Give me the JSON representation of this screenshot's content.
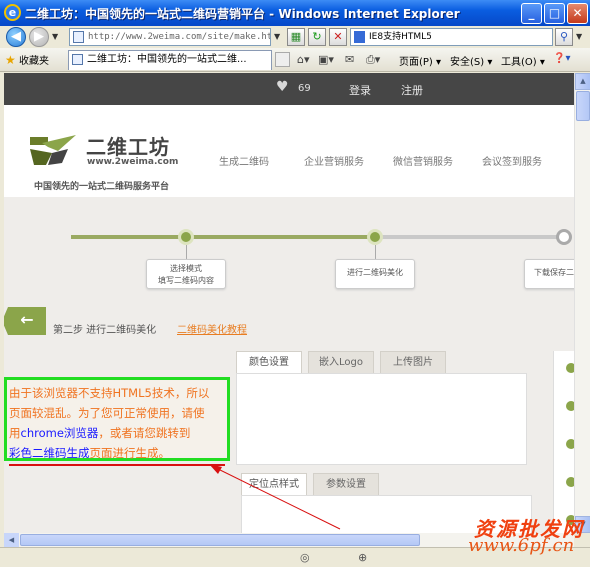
{
  "window": {
    "title": "二维工坊：中国领先的一站式二维码营销平台 - Windows Internet Explorer",
    "min": "_",
    "max": "□",
    "close": "✕"
  },
  "addressbar": {
    "url": "http://www.2weima.com/site/make.html",
    "search_value": "IE8支持HTML5"
  },
  "favbar": {
    "favorites_label": "收藏夹",
    "tab_title": "二维工坊：中国领先的一站式二维...",
    "page_menu": "页面(P) ▾",
    "safety_menu": "安全(S) ▾",
    "tools_menu": "工具(O) ▾",
    "help_menu": "❓▾"
  },
  "site": {
    "topbar": {
      "likes": "69",
      "login": "登录",
      "register": "注册"
    },
    "logo": {
      "name": "二维工坊",
      "url": "www.2weima.com",
      "slogan": "中国领先的一站式二维码服务平台"
    },
    "nav": [
      "生成二维码",
      "企业营销服务",
      "微信营销服务",
      "会议签到服务"
    ],
    "steps": [
      {
        "line1": "选择模式",
        "line2": "填写二维码内容"
      },
      {
        "line1": "进行二维码美化",
        "line2": ""
      },
      {
        "line1": "下载保存二",
        "line2": ""
      }
    ],
    "back_arrow": "←",
    "step_title": "第二步 进行二维码美化",
    "step_link": "二维码美化教程",
    "tabs_top": [
      "颜色设置",
      "嵌入Logo",
      "上传图片"
    ],
    "tabs_bottom": [
      "定位点样式",
      "参数设置"
    ]
  },
  "annotation": {
    "line1": "由于该浏览器不支持HTML5技术，所以",
    "line2": "页面较混乱。为了您可正常使用，请使",
    "line3_a": "用",
    "line3_b": "chrome浏览器",
    "line3_c": "，或者请您跳转到",
    "line4_a": "彩色二维码生成",
    "line4_b": "页面进行生成。"
  },
  "watermark": {
    "line1": "资源批发网",
    "line2": "www.6pf.cn"
  },
  "colors": {
    "accent_green": "#8ba54a",
    "link_orange": "#e87d22",
    "annotation_border": "#22dd22"
  }
}
